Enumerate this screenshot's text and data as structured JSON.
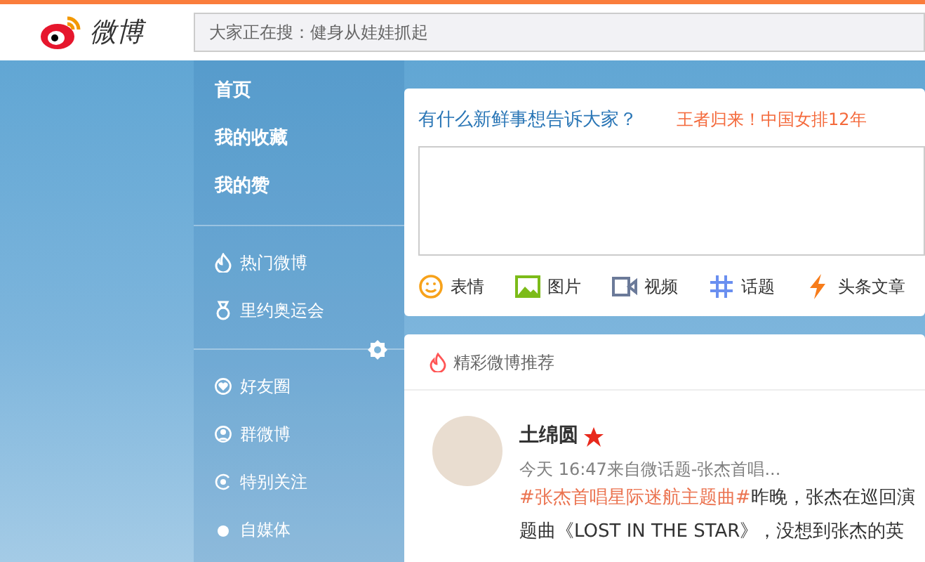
{
  "header": {
    "logo": "微博",
    "search": {
      "placeholder": "大家正在搜：健身从娃娃抓起"
    }
  },
  "sidebar": {
    "groups": [
      {
        "items": [
          {
            "label": "首页",
            "kind": "main"
          },
          {
            "label": "我的收藏",
            "kind": "main"
          },
          {
            "label": "我的赞",
            "kind": "main"
          }
        ]
      },
      {
        "items": [
          {
            "label": "热门微博",
            "kind": "flame"
          },
          {
            "label": "里约奥运会",
            "kind": "medal"
          }
        ]
      },
      {
        "items": [
          {
            "label": "好友圈",
            "kind": "heart"
          },
          {
            "label": "群微博",
            "kind": "person"
          },
          {
            "label": "特别关注",
            "kind": "eye"
          },
          {
            "label": "自媒体",
            "kind": "dot"
          }
        ]
      }
    ]
  },
  "composer": {
    "prompt": "有什么新鲜事想告诉大家？",
    "trending": "王者归来！中国女排12年",
    "tools": [
      {
        "label": "表情",
        "kind": "smiley"
      },
      {
        "label": "图片",
        "kind": "picture"
      },
      {
        "label": "视频",
        "kind": "video"
      },
      {
        "label": "话题",
        "kind": "hash"
      },
      {
        "label": "头条文章",
        "kind": "bolt"
      }
    ]
  },
  "feed": {
    "title": "精彩微博推荐",
    "post": {
      "author": "土绵圆",
      "time": "今天 16:47来自微话题-张杰首唱...",
      "topic": "#张杰首唱星际迷航主题曲#",
      "lines": [
        "昨晚，张杰在巡回演",
        "题曲《LOST IN THE STAR》，没想到张杰的英"
      ]
    }
  }
}
